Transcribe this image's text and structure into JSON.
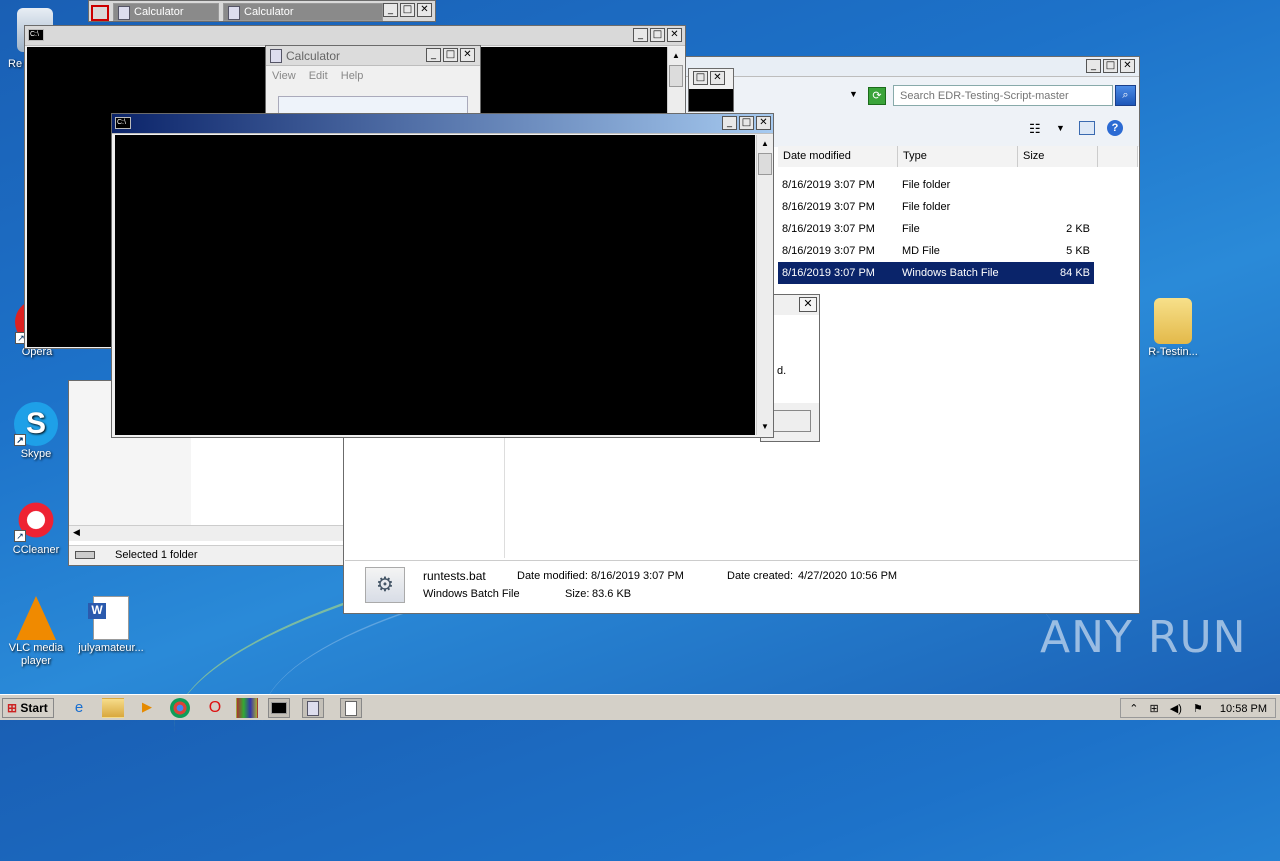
{
  "desktop": {
    "icons": [
      {
        "label": "Re"
      },
      {
        "label": "Opera"
      },
      {
        "label": "Skype"
      },
      {
        "label": "CCleaner"
      },
      {
        "label": "VLC media player"
      },
      {
        "label": "julyamateur..."
      },
      {
        "label": "R-Testin..."
      }
    ],
    "watermark": "ANY RUN"
  },
  "calc_tabs": [
    {
      "label": "Calculator"
    },
    {
      "label": "Calculator"
    }
  ],
  "calculator": {
    "title": "Calculator",
    "menu": [
      "View",
      "Edit",
      "Help"
    ]
  },
  "explorer": {
    "search_placeholder": "Search EDR-Testing-Script-master",
    "columns": [
      "Date modified",
      "Type",
      "Size"
    ],
    "rows": [
      {
        "date": "8/16/2019 3:07 PM",
        "type": "File folder",
        "size": ""
      },
      {
        "date": "8/16/2019 3:07 PM",
        "type": "File folder",
        "size": ""
      },
      {
        "date": "8/16/2019 3:07 PM",
        "type": "File",
        "size": "2 KB"
      },
      {
        "date": "8/16/2019 3:07 PM",
        "type": "MD File",
        "size": "5 KB"
      },
      {
        "date": "8/16/2019 3:07 PM",
        "type": "Windows Batch File",
        "size": "84 KB"
      }
    ],
    "details": {
      "name": "runtests.bat",
      "kind": "Windows Batch File",
      "date_modified_label": "Date modified:",
      "date_modified": "8/16/2019 3:07 PM",
      "date_created_label": "Date created:",
      "date_created": "4/27/2020 10:56 PM",
      "size_label": "Size:",
      "size": "83.6 KB"
    },
    "dialog_fragment": "d."
  },
  "back_explorer": {
    "status": "Selected 1 folder"
  },
  "taskbar": {
    "start_label": "Start",
    "clock": "10:58 PM"
  }
}
